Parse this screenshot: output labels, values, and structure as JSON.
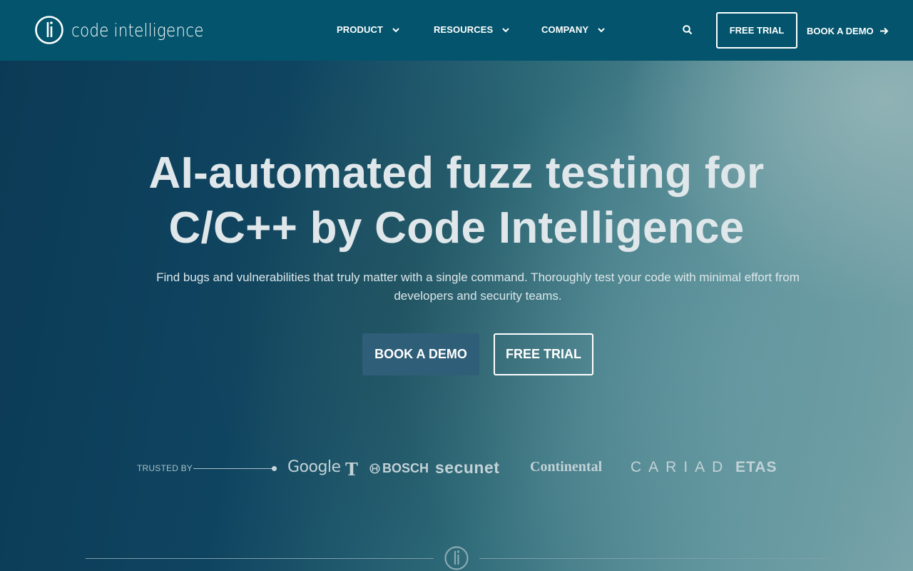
{
  "nav": {
    "logo_text": "code intelligence",
    "logo_icon": "ci-logo-icon",
    "items": [
      {
        "label": "PRODUCT",
        "icon": "chevron-down-icon"
      },
      {
        "label": "RESOURCES",
        "icon": "chevron-down-icon"
      },
      {
        "label": "COMPANY",
        "icon": "chevron-down-icon"
      }
    ],
    "search_icon": "search-icon",
    "free_trial_label": "FREE TRIAL",
    "book_demo_label": "BOOK A DEMO",
    "book_demo_icon": "arrow-right-icon"
  },
  "hero": {
    "headline_line1": "AI-automated fuzz testing for",
    "headline_line2": "C/C++ by Code Intelligence",
    "subline": "Find bugs and vulnerabilities that truly matter with a single command. Thoroughly test your code with minimal effort from developers and security teams.",
    "book_demo_label": "BOOK A DEMO",
    "free_trial_label": "FREE TRIAL"
  },
  "trusted": {
    "label": "TRUSTED BY",
    "brands": {
      "google": "Google",
      "telekom": "T",
      "bosch": "BOSCH",
      "secunet": "secunet",
      "continental": "Continental",
      "cariad": "CARIAD",
      "etas": "ETAS"
    }
  },
  "colors": {
    "nav_bg": "#03546c",
    "primary_button": "#2f5e78",
    "text_light": "#dfe7ea"
  }
}
